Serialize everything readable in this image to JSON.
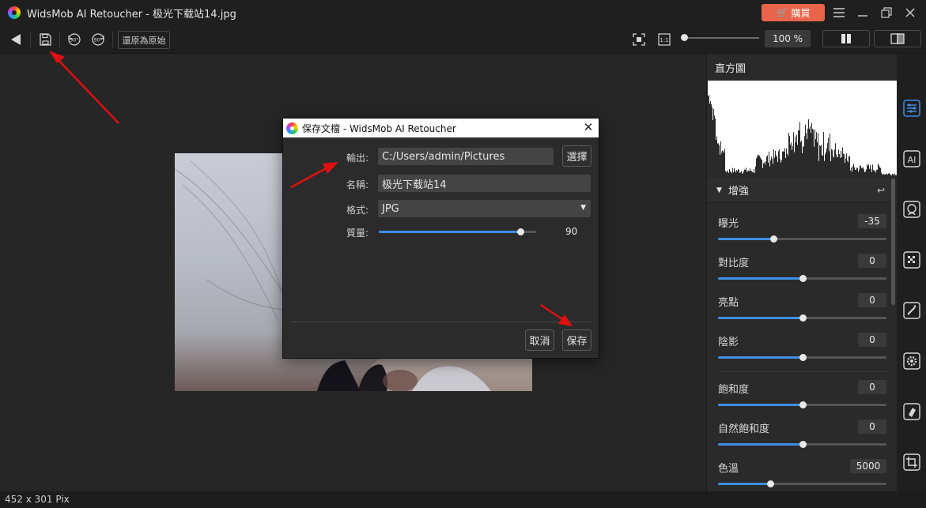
{
  "window": {
    "title": "WidsMob AI Retoucher - 极光下载站14.jpg",
    "buy_label": "購買"
  },
  "toolbar": {
    "reset_label": "還原為原始",
    "zoom_value": "100 %",
    "zoom_level": 1.0
  },
  "status": {
    "dimensions": "452 x 301 Pix"
  },
  "panel": {
    "histogram_title": "直方圖",
    "enhance_title": "增強",
    "adjustments": [
      {
        "label": "曝光",
        "value": "-35",
        "position": 0.33
      },
      {
        "label": "對比度",
        "value": "0",
        "position": 0.5
      },
      {
        "label": "亮點",
        "value": "0",
        "position": 0.5
      },
      {
        "label": "陰影",
        "value": "0",
        "position": 0.5
      },
      {
        "label": "飽和度",
        "value": "0",
        "position": 0.5
      },
      {
        "label": "自然飽和度",
        "value": "0",
        "position": 0.5
      },
      {
        "label": "色溫",
        "value": "5000",
        "position": 0.31
      }
    ]
  },
  "dialog": {
    "title": "保存文檔 - WidsMob AI Retoucher",
    "output_label": "輸出:",
    "output_path": "C:/Users/admin/Pictures",
    "choose_label": "選擇",
    "name_label": "名稱:",
    "name_value": "极光下载站14",
    "format_label": "格式:",
    "format_value": "JPG",
    "quality_label": "質量:",
    "quality_value": "90",
    "quality_fraction": 0.9,
    "cancel_label": "取消",
    "save_label": "保存"
  },
  "colors": {
    "accent": "#3e8fe6",
    "buy_button": "#e8644a",
    "annotation_arrow": "#e01010"
  }
}
